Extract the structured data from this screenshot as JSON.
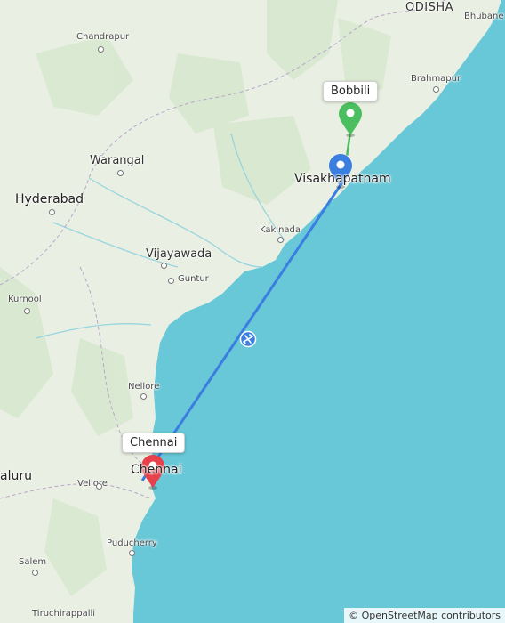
{
  "map": {
    "colors": {
      "land": "#e9efe2",
      "sea": "#68c8d8",
      "route": "#3a7ee0",
      "start_pin": "#4bbf60",
      "end_pin": "#e8414b",
      "current_pin": "#3a7ee0"
    },
    "region_labels": {
      "odisha": "ODISHA"
    },
    "cities": {
      "bhubaneswar": "Bhubane",
      "chandrapur": "Chandrapur",
      "brahmapur": "Brahmapur",
      "warangal": "Warangal",
      "hyderabad": "Hyderabad",
      "visakhapatnam": "Visakhapatnam",
      "kakinada": "Kakinada",
      "vijayawada": "Vijayawada",
      "guntur": "Guntur",
      "kurnool": "Kurnool",
      "nellore": "Nellore",
      "bengaluru": "aluru",
      "vellore": "Vellore",
      "chennai_city": "Chennai",
      "puducherry": "Puducherry",
      "salem": "Salem",
      "tiruchirappalli": "Tiruchirappalli"
    },
    "markers": {
      "start_label": "Bobbili",
      "end_label": "Chennai"
    },
    "attribution": "© OpenStreetMap contributors"
  }
}
